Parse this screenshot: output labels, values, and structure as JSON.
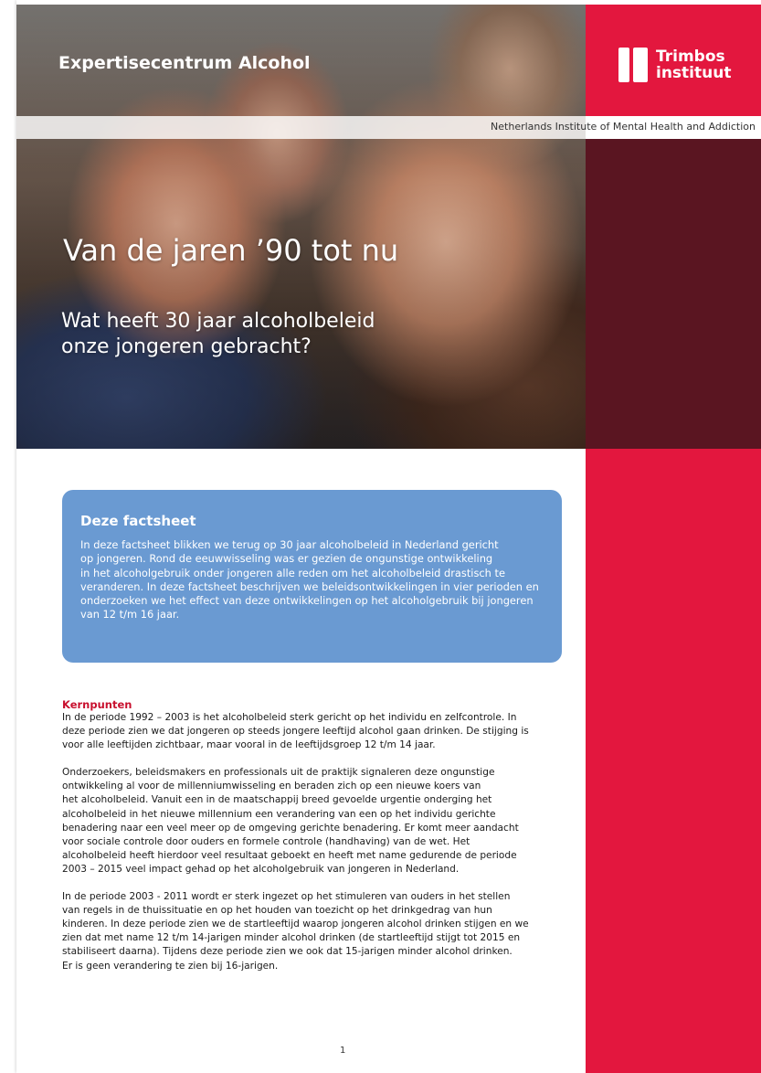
{
  "header": {
    "expertise": "Expertisecentrum Alcohol",
    "logo_line1": "Trimbos",
    "logo_line2": "instituut",
    "institute_tagline": "Netherlands Institute of Mental Health and Addiction"
  },
  "hero": {
    "title": "Van de jaren ’90 tot nu",
    "subtitle_lines": [
      "Wat heeft 30 jaar alcoholbeleid",
      "onze jongeren gebracht?"
    ]
  },
  "factsheet": {
    "heading": "Deze factsheet",
    "lines": [
      "In deze factsheet blikken we terug op 30 jaar alcoholbeleid in Nederland gericht",
      "op jongeren. Rond de eeuwwisseling was er gezien de ongunstige ontwikkeling",
      "in het alcoholgebruik onder jongeren alle reden om het alcoholbeleid drastisch te",
      "veranderen. In deze factsheet beschrijven we beleidsontwikkelingen in vier perioden en",
      "onderzoeken we het effect van deze ontwikkelingen op het alcoholgebruik bij jongeren",
      "van 12 t/m 16 jaar."
    ]
  },
  "body": {
    "section_heading": "Kernpunten",
    "paragraphs": [
      [
        "In de periode 1992 – 2003 is het alcoholbeleid sterk gericht op het individu en zelfcontrole. In",
        "deze periode zien we dat jongeren op steeds jongere leeftijd alcohol gaan drinken. De stijging is",
        "voor alle leeftijden zichtbaar, maar vooral in de leeftijdsgroep 12 t/m 14 jaar."
      ],
      [
        "Onderzoekers, beleidsmakers en professionals uit de praktijk signaleren deze ongunstige",
        "ontwikkeling al voor de millenniumwisseling en beraden zich op een nieuwe koers van",
        "het alcoholbeleid. Vanuit een in de maatschappij breed gevoelde urgentie onderging het",
        "alcoholbeleid in het nieuwe millennium een verandering van een op het individu gerichte",
        "benadering naar een veel meer op de omgeving gerichte benadering. Er komt meer aandacht",
        "voor sociale controle door ouders en formele controle (handhaving) van de wet. Het",
        "alcoholbeleid heeft hierdoor veel resultaat geboekt en heeft met name gedurende de periode",
        "2003 – 2015 veel impact gehad op het alcoholgebruik van jongeren in Nederland."
      ],
      [
        "In de periode 2003 - 2011 wordt er sterk ingezet op het stimuleren van ouders in het stellen",
        "van regels in de thuissituatie en op het houden van toezicht op het drinkgedrag van hun",
        "kinderen. In deze periode zien we de startleeftijd waarop jongeren alcohol drinken stijgen en we",
        "zien dat met name 12 t/m 14-jarigen minder alcohol drinken (de startleeftijd stijgt tot 2015 en",
        "stabiliseert daarna). Tijdens deze periode zien we ook dat 15-jarigen minder alcohol drinken.",
        "Er is geen verandering te zien bij 16-jarigen."
      ]
    ]
  },
  "footer": {
    "page_number": "1"
  }
}
